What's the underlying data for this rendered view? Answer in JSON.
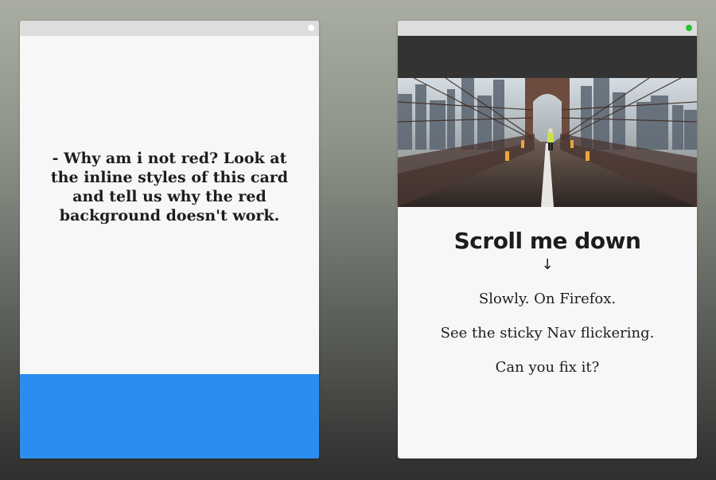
{
  "left_card": {
    "message": "- Why am i not red? Look at the inline styles of this card and tell us why the red background doesn't work.",
    "titlebar_dot_color": "#ffffff",
    "footer_color": "#2b8def"
  },
  "right_card": {
    "titlebar_dot_color": "#29c42d",
    "nav_color": "#333333",
    "hero_image": "bridge-photo",
    "title": "Scroll me down",
    "arrow": "↓",
    "paragraphs": [
      "Slowly. On Firefox.",
      "See the sticky Nav flickering.",
      "Can you fix it?"
    ]
  }
}
